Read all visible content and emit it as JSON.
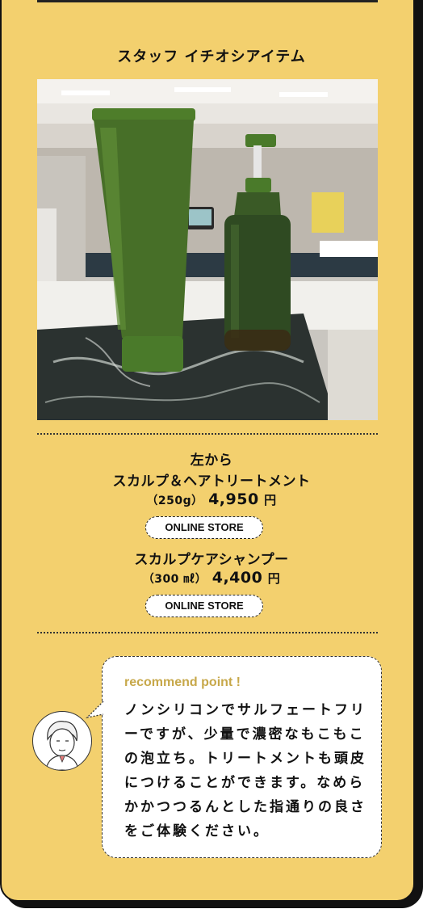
{
  "section_title": "スタッフ イチオシアイテム",
  "products": {
    "intro": "左から",
    "item1": {
      "name": "スカルプ＆ヘアトリートメント",
      "size": "（250g）",
      "price": "4,950",
      "yen": "円",
      "store_label": "ONLINE STORE"
    },
    "item2": {
      "name": "スカルプケアシャンプー",
      "size": "（300 ㎖）",
      "price": "4,400",
      "yen": "円",
      "store_label": "ONLINE STORE"
    }
  },
  "recommend": {
    "title": "recommend point !",
    "body": "ノンシリコンでサルフェートフリーですが、少量で濃密なもこもこの泡立ち。トリートメントも頭皮につけることができます。なめらかかつつるんとした指通りの良さをご体験ください。"
  },
  "colors": {
    "background": "#f3d06e",
    "product_green": "#3f6b24",
    "accent_text": "#c7a84a"
  }
}
